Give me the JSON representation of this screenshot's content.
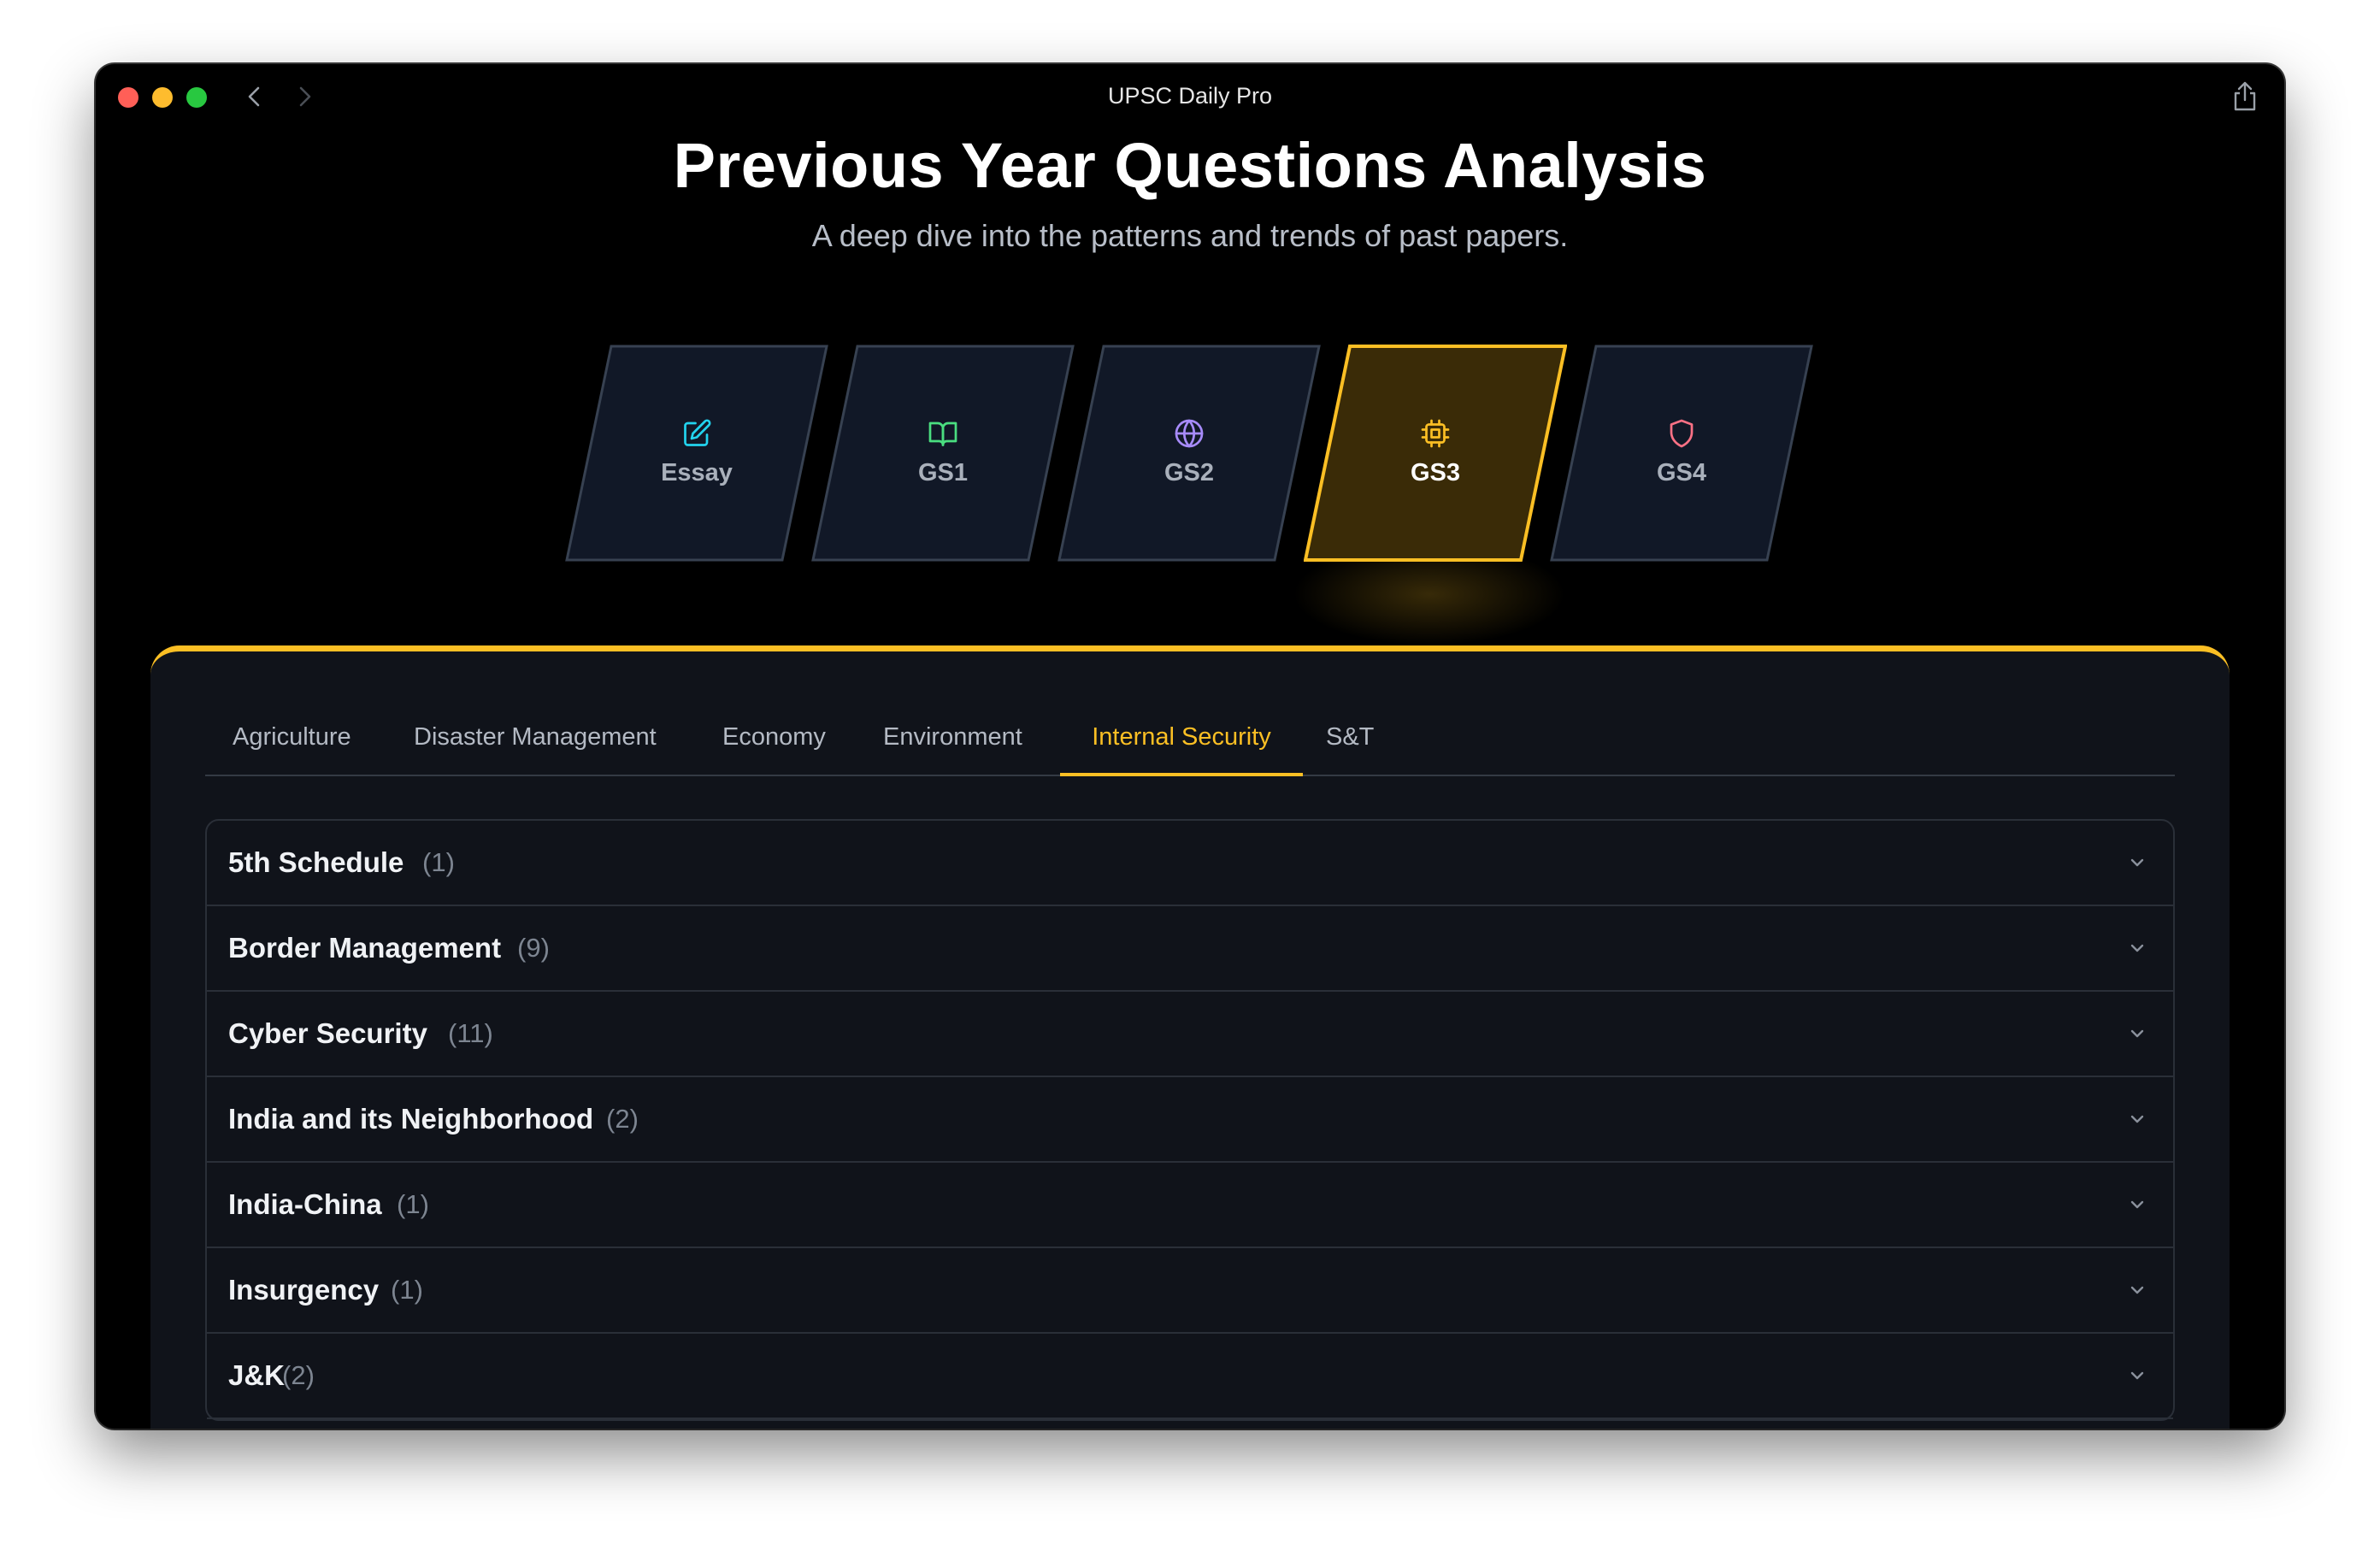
{
  "window": {
    "title": "UPSC Daily Pro"
  },
  "header": {
    "title": "Previous Year Questions Analysis",
    "subtitle": "A deep dive into the patterns and trends of past papers."
  },
  "papers": [
    {
      "label": "Essay",
      "icon": "pencil-square-icon",
      "color": "#22d3ee",
      "active": false
    },
    {
      "label": "GS1",
      "icon": "book-open-icon",
      "color": "#4ade80",
      "active": false
    },
    {
      "label": "GS2",
      "icon": "globe-icon",
      "color": "#a78bfa",
      "active": false
    },
    {
      "label": "GS3",
      "icon": "chip-icon",
      "color": "#fbbf24",
      "active": true
    },
    {
      "label": "GS4",
      "icon": "shield-icon",
      "color": "#fb7185",
      "active": false
    }
  ],
  "tabs": [
    {
      "label": "Agriculture",
      "active": false
    },
    {
      "label": "Disaster Management",
      "active": false
    },
    {
      "label": "Economy",
      "active": false
    },
    {
      "label": "Environment",
      "active": false
    },
    {
      "label": "Internal Security",
      "active": true
    },
    {
      "label": "S&T",
      "active": false
    }
  ],
  "topics": [
    {
      "title": "5th Schedule",
      "count": "(1)"
    },
    {
      "title": "Border Management",
      "count": "(9)"
    },
    {
      "title": "Cyber Security",
      "count": "(11)"
    },
    {
      "title": "India and its Neighborhood",
      "count": "(2)"
    },
    {
      "title": "India-China",
      "count": "(1)"
    },
    {
      "title": "Insurgency",
      "count": "(1)"
    },
    {
      "title": "J&K",
      "count": "(2)"
    }
  ],
  "colors": {
    "accent": "#fbbf24",
    "panel": "#10131a",
    "card": "#111827"
  }
}
